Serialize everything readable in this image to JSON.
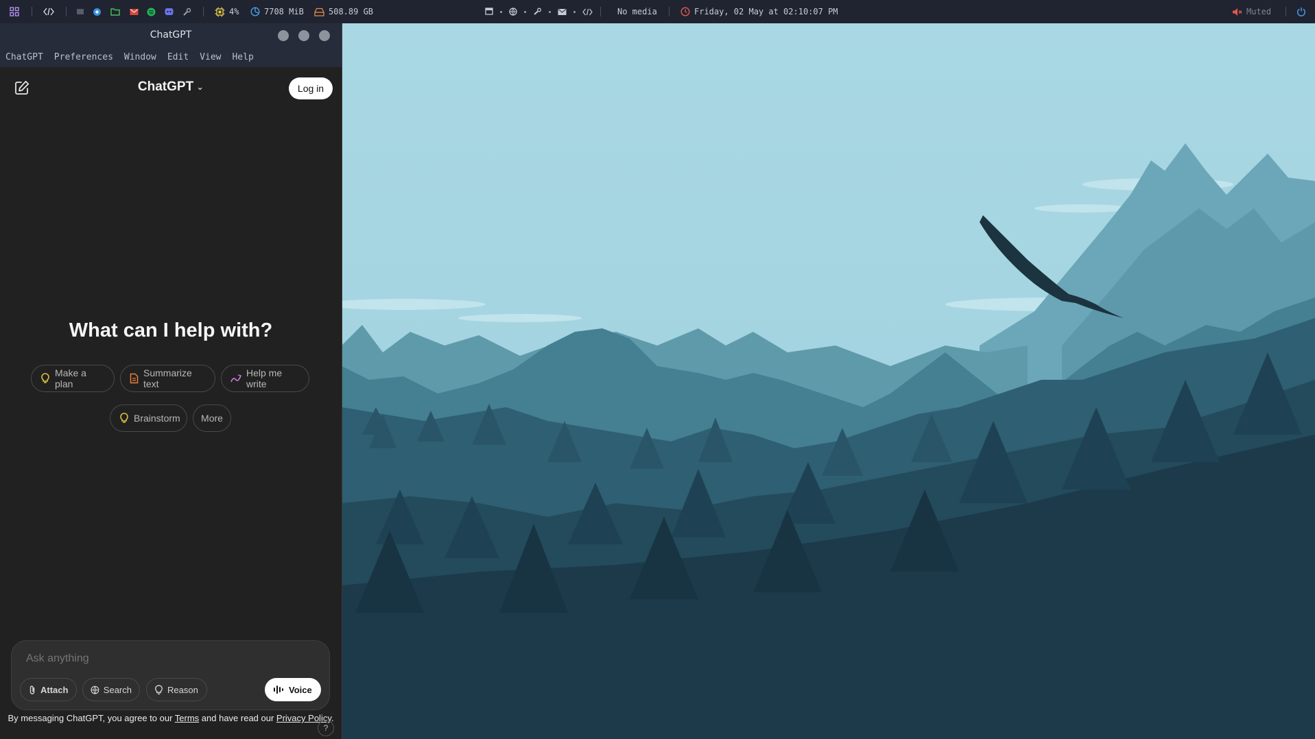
{
  "topbar": {
    "cpu": "4%",
    "memory": "7708 MiB",
    "disk": "508.89 GB",
    "media": "No media",
    "clock": "Friday, 02 May at 02:10:07 PM",
    "volume": "Muted",
    "icons": [
      "apps-grid-icon",
      "code-icon",
      "terminal-icon",
      "browser-icon",
      "files-icon",
      "mail-icon",
      "spotify-icon",
      "discord-icon",
      "steam-icon",
      "cpu-icon",
      "memory-icon",
      "disk-icon",
      "window-icon",
      "globe-icon",
      "steam-icon",
      "mail-icon",
      "code-icon",
      "clock-icon",
      "muted-speaker-icon",
      "power-icon"
    ]
  },
  "window": {
    "title": "ChatGPT",
    "menu": [
      "ChatGPT",
      "Preferences",
      "Window",
      "Edit",
      "View",
      "Help"
    ]
  },
  "app": {
    "model_name": "ChatGPT",
    "login_label": "Log in",
    "headline": "What can I help with?",
    "suggestions": [
      {
        "label": "Make a plan",
        "icon": "lightbulb-icon",
        "color": "#e2c541"
      },
      {
        "label": "Summarize text",
        "icon": "document-icon",
        "color": "#e8823a"
      },
      {
        "label": "Help me write",
        "icon": "pen-icon",
        "color": "#c77dd8"
      },
      {
        "label": "Brainstorm",
        "icon": "lightbulb-icon",
        "color": "#e2c541"
      },
      {
        "label": "More",
        "icon": "",
        "color": ""
      }
    ],
    "composer": {
      "placeholder": "Ask anything",
      "attach": "Attach",
      "search": "Search",
      "reason": "Reason",
      "voice": "Voice"
    },
    "disclaimer": {
      "prefix": "By messaging ChatGPT, you agree to our ",
      "terms": "Terms",
      "middle": " and have read our ",
      "privacy": "Privacy Policy",
      "suffix": "."
    },
    "help": "?"
  },
  "colors": {
    "sky": "#a7d7e3",
    "app_bg": "#212121",
    "topbar_bg": "#1f2430"
  }
}
